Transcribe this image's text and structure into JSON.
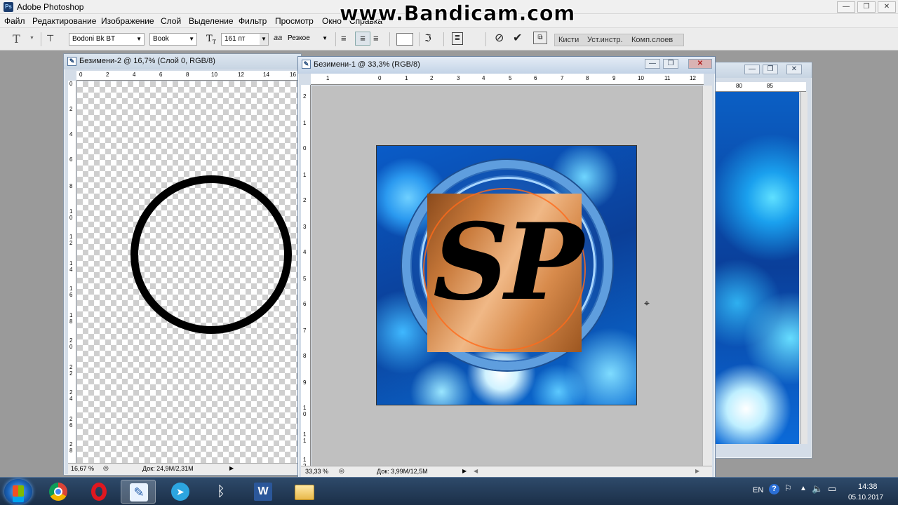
{
  "app": {
    "title": "Adobe Photoshop",
    "watermark": "www.Bandicam.com"
  },
  "window_controls": {
    "minimize": "—",
    "maximize": "❐",
    "close": "✕"
  },
  "menu": [
    "Файл",
    "Редактирование",
    "Изображение",
    "Слой",
    "Выделение",
    "Фильтр",
    "Просмотр",
    "Окно",
    "Справка"
  ],
  "options": {
    "tool_glyph": "T",
    "font_family": "Bodoni Bk BT",
    "font_style": "Book",
    "font_size": "161 пт",
    "antialias_label": "aa",
    "antialias": "Резкое",
    "palette_tabs": [
      "Кисти",
      "Уст.инстр.",
      "Комп.слоев"
    ]
  },
  "doc2": {
    "title": "Безимени-2 @ 16,7% (Слой 0, RGB/8)",
    "ruler_top": [
      "0",
      "2",
      "4",
      "6",
      "8",
      "10",
      "12",
      "14",
      "16"
    ],
    "ruler_left": [
      "0",
      "2",
      "4",
      "6",
      "8",
      "1 0",
      "1 2",
      "1 4",
      "1 6",
      "1 8",
      "2 0",
      "2 2",
      "2 4",
      "2 6",
      "2 8"
    ],
    "zoom": "16,67 %",
    "doc_info": "Док: 24,9M/2,31M"
  },
  "doc1": {
    "title": "Безимени-1 @ 33,3% (RGB/8)",
    "ruler_top": [
      "1",
      "0",
      "1",
      "2",
      "3",
      "4",
      "5",
      "6",
      "7",
      "8",
      "9",
      "10",
      "11",
      "12"
    ],
    "ruler_left": [
      "2",
      "1",
      "0",
      "1",
      "2",
      "3",
      "4",
      "5",
      "6",
      "7",
      "8",
      "9",
      "1 0",
      "1 1",
      "1 2"
    ],
    "canvas_text": "SP",
    "zoom": "33,33 %",
    "doc_info": "Док: 3,99M/12,5M"
  },
  "doc3": {
    "ruler_top": [
      "80",
      "85"
    ]
  },
  "taskbar": {
    "apps": [
      "start",
      "chrome",
      "opera",
      "photoshop",
      "telegram",
      "bluetooth",
      "word",
      "explorer"
    ],
    "active_app": "photoshop",
    "word_letter": "W",
    "lang": "EN",
    "time": "14:38",
    "date": "05.10.2017"
  },
  "colors": {
    "titlebar": "#f0f0f0",
    "doc_frame": "#d4dde8",
    "workspace": "#9a9a9a",
    "taskbar": "#1b2f48",
    "bokeh_blue": "#0a5cc8",
    "copper": "#c8793a"
  }
}
